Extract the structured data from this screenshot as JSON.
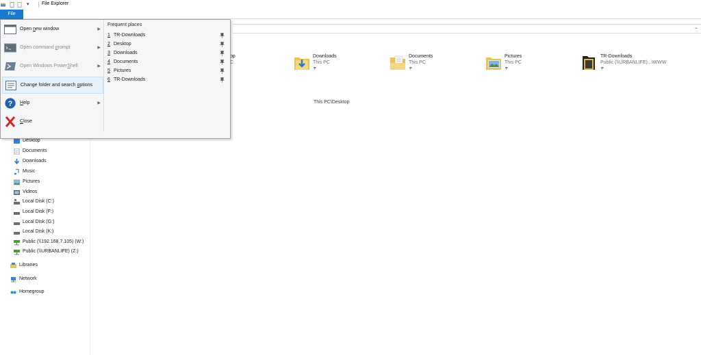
{
  "window": {
    "title": "File Explorer"
  },
  "ribbon": {
    "file_tab": "File"
  },
  "file_menu": {
    "items": [
      {
        "pre": "Open ",
        "key": "n",
        "post": "ew window",
        "arrow": true,
        "disabled": false
      },
      {
        "pre": "Open command ",
        "key": "p",
        "post": "rompt",
        "arrow": true,
        "disabled": true
      },
      {
        "pre": "Open Windows Power",
        "key": "S",
        "post": "hell",
        "arrow": true,
        "disabled": true
      },
      {
        "pre": "Change folder and search ",
        "key": "o",
        "post": "ptions",
        "arrow": false,
        "disabled": false
      },
      {
        "pre": "",
        "key": "H",
        "post": "elp",
        "arrow": true,
        "disabled": false
      },
      {
        "pre": "",
        "key": "C",
        "post": "lose",
        "arrow": false,
        "disabled": false
      }
    ],
    "frequent_title": "Frequent places",
    "frequent": [
      {
        "num": "1",
        "label": "TR-Downloads"
      },
      {
        "num": "2",
        "label": "Desktop"
      },
      {
        "num": "3",
        "label": "Downloads"
      },
      {
        "num": "4",
        "label": "Documents"
      },
      {
        "num": "5",
        "label": "Pictures"
      },
      {
        "num": "6",
        "label": "TR-Downloads"
      }
    ]
  },
  "quick_access": {
    "partial_sub_1": "op",
    "partial_sub_2": "C",
    "tiles": [
      {
        "name": "Downloads",
        "sub": "This PC"
      },
      {
        "name": "Documents",
        "sub": "This PC"
      },
      {
        "name": "Pictures",
        "sub": "This PC"
      },
      {
        "name": "TR-Downloads",
        "sub": "Public (\\\\URBANLIFE)...\\WWW"
      }
    ]
  },
  "recent": {
    "path": "This PC\\Desktop"
  },
  "nav_pane": {
    "items": [
      {
        "label": "Desktop",
        "icon": "desktop-icon"
      },
      {
        "label": "Documents",
        "icon": "documents-icon"
      },
      {
        "label": "Downloads",
        "icon": "downloads-icon"
      },
      {
        "label": "Music",
        "icon": "music-icon"
      },
      {
        "label": "Pictures",
        "icon": "pictures-icon"
      },
      {
        "label": "Videos",
        "icon": "videos-icon"
      },
      {
        "label": "Local Disk (C:)",
        "icon": "drive-icon"
      },
      {
        "label": "Local Disk (F:)",
        "icon": "drive-icon"
      },
      {
        "label": "Local Disk (G:)",
        "icon": "drive-icon"
      },
      {
        "label": "Local Disk (K:)",
        "icon": "drive-icon"
      },
      {
        "label": "Public (\\\\192.168.7.105) (W:)",
        "icon": "network-drive-icon"
      },
      {
        "label": "Public (\\\\URBANLIFE) (Z:)",
        "icon": "network-drive-icon"
      },
      {
        "label": "Libraries",
        "icon": "libraries-icon"
      },
      {
        "label": "Network",
        "icon": "network-icon"
      },
      {
        "label": "Homegroup",
        "icon": "homegroup-icon"
      }
    ]
  },
  "colors": {
    "accent": "#1979ca",
    "menu_bg": "#f5f6f7",
    "selection": "#e5f1fb",
    "folder": "#e8c35a"
  }
}
